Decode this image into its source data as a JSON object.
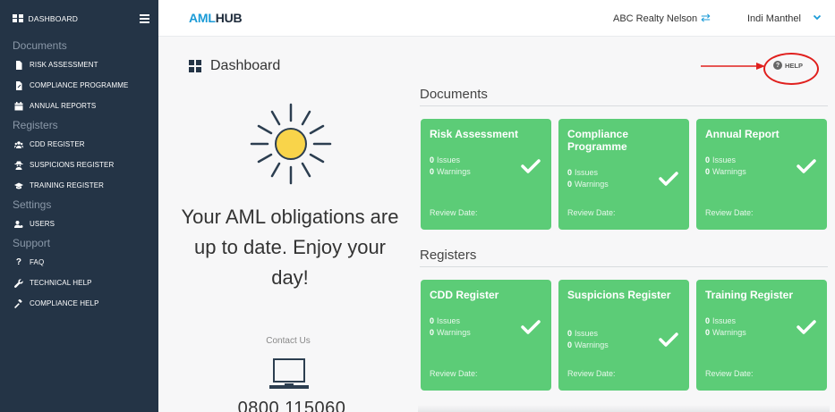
{
  "sidebar": {
    "header_label": "DASHBOARD",
    "sections": [
      {
        "title": "Documents",
        "items": [
          "RISK ASSESSMENT",
          "COMPLIANCE PROGRAMME",
          "ANNUAL REPORTS"
        ]
      },
      {
        "title": "Registers",
        "items": [
          "CDD REGISTER",
          "SUSPICIONS REGISTER",
          "TRAINING REGISTER"
        ]
      },
      {
        "title": "Settings",
        "items": [
          "USERS"
        ]
      },
      {
        "title": "Support",
        "items": [
          "FAQ",
          "TECHNICAL HELP",
          "COMPLIANCE HELP"
        ]
      }
    ]
  },
  "header": {
    "logo_aml": "AML",
    "logo_hub": "HUB",
    "organisation": "ABC Realty Nelson",
    "user_name": "Indi Manthel"
  },
  "main": {
    "page_title": "Dashboard",
    "help_label": "HELP",
    "tagline": "Your AML obligations are up to date. Enjoy your day!",
    "contact_label": "Contact Us",
    "phone": "0800 115060",
    "documents_title": "Documents",
    "registers_title": "Registers",
    "documents": [
      {
        "title": "Risk Assessment",
        "issues": "0",
        "issues_label": "Issues",
        "warnings": "0",
        "warnings_label": "Warnings",
        "review": "Review Date:"
      },
      {
        "title": "Compliance Programme",
        "issues": "0",
        "issues_label": "Issues",
        "warnings": "0",
        "warnings_label": "Warnings",
        "review": "Review Date:"
      },
      {
        "title": "Annual Report",
        "issues": "0",
        "issues_label": "Issues",
        "warnings": "0",
        "warnings_label": "Warnings",
        "review": "Review Date:"
      }
    ],
    "registers": [
      {
        "title": "CDD Register",
        "issues": "0",
        "issues_label": "Issues",
        "warnings": "0",
        "warnings_label": "Warnings",
        "review": "Review Date:"
      },
      {
        "title": "Suspicions Register",
        "issues": "0",
        "issues_label": "Issues",
        "warnings": "0",
        "warnings_label": "Warnings",
        "review": "Review Date:"
      },
      {
        "title": "Training Register",
        "issues": "0",
        "issues_label": "Issues",
        "warnings": "0",
        "warnings_label": "Warnings",
        "review": "Review Date:"
      }
    ]
  },
  "colors": {
    "sidebar_bg": "#243446",
    "card_green": "#5ccc77",
    "brand_blue": "#1b9bd7",
    "annotation_red": "#e0201e"
  }
}
